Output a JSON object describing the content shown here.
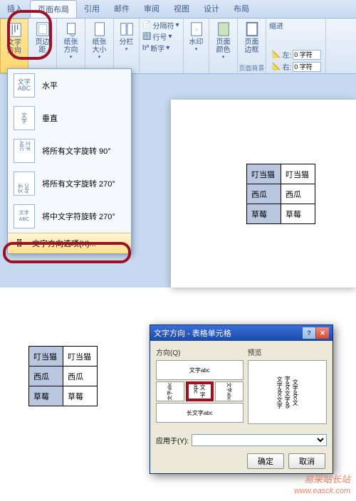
{
  "tabs": [
    "插入",
    "页面布局",
    "引用",
    "邮件",
    "审阅",
    "视图",
    "设计",
    "布局"
  ],
  "active_tab": 1,
  "ribbon": {
    "text_direction": "文字方向",
    "margins": "页边距",
    "paper_orient": "纸张方向",
    "paper_size": "纸张大小",
    "columns": "分栏",
    "breaks": "分隔符",
    "line_num": "行号",
    "hyphen": "断字",
    "watermark": "水印",
    "page_color": "页面颜色",
    "page_border": "页面边框",
    "page_bg_group": "页面背景",
    "indent_group": "缩进",
    "indent_left_lbl": "左:",
    "indent_right_lbl": "右:",
    "indent_left_val": "0 字符",
    "indent_right_val": "0 字符"
  },
  "dropdown": {
    "items": [
      {
        "icon": "文字\nABC",
        "label": "水平"
      },
      {
        "icon": "文\n字",
        "label": "垂直"
      },
      {
        "icon": "文字\nABC",
        "label": "将所有文字旋转 90°"
      },
      {
        "icon": "文字\nABC",
        "label": "将所有文字旋转 270°"
      },
      {
        "icon": "文字\nABC",
        "label": "将中文字符旋转 270°"
      }
    ],
    "last": "文字方向选项(X)..."
  },
  "table_data": {
    "rows": [
      [
        "叮当猫",
        "叮当猫"
      ],
      [
        "西瓜",
        "西瓜"
      ],
      [
        "草莓",
        "草莓"
      ]
    ]
  },
  "dialog": {
    "title": "文字方向 - 表格单元格",
    "orient_label": "方向(Q)",
    "preview_label": "预览",
    "sample": "文字abc",
    "sample_v": "文\n字\nabc",
    "preview_lines": [
      "文字abc文字",
      "字abc文字ab",
      "文字abc文"
    ],
    "apply_label": "应用于(Y):",
    "apply_options": [
      ""
    ],
    "ok": "确定",
    "cancel": "取消"
  },
  "watermark": {
    "line1": "易采站长站",
    "line2": "www.easck.com"
  }
}
